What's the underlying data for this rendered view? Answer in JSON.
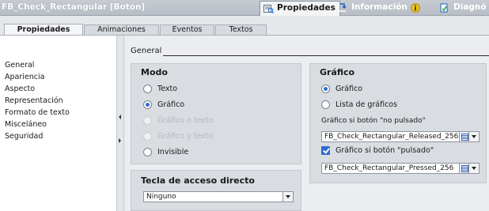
{
  "window": {
    "title": "FB_Check_Rectangular [Botón]"
  },
  "inspector_tabs": [
    {
      "label": "Propiedades",
      "icon": "properties-icon",
      "active": true
    },
    {
      "label": "Información",
      "icon": "info-link-icon",
      "badge_icon": "info-badge-icon",
      "active": false
    },
    {
      "label": "Diagnó",
      "icon": "diagnostics-icon",
      "active": false
    }
  ],
  "sub_tabs": [
    {
      "label": "Propiedades",
      "active": true
    },
    {
      "label": "Animaciones",
      "active": false
    },
    {
      "label": "Eventos",
      "active": false
    },
    {
      "label": "Textos",
      "active": false
    }
  ],
  "nav": {
    "items": [
      {
        "label": "General",
        "selected": true
      },
      {
        "label": "Apariencia",
        "selected": false
      },
      {
        "label": "Aspecto",
        "selected": false
      },
      {
        "label": "Representación",
        "selected": false
      },
      {
        "label": "Formato de texto",
        "selected": false
      },
      {
        "label": "Misceláneo",
        "selected": false
      },
      {
        "label": "Seguridad",
        "selected": false
      }
    ]
  },
  "main": {
    "section_title": "General",
    "modo": {
      "title": "Modo",
      "options": [
        {
          "label": "Texto",
          "checked": false,
          "disabled": false
        },
        {
          "label": "Gráfico",
          "checked": true,
          "disabled": false
        },
        {
          "label": "Gráfico o texto",
          "checked": false,
          "disabled": true
        },
        {
          "label": "Gráfico y texto",
          "checked": false,
          "disabled": true
        },
        {
          "label": "Invisible",
          "checked": false,
          "disabled": false
        }
      ]
    },
    "hotkey": {
      "title": "Tecla de acceso directo",
      "value": "Ninguno"
    },
    "grafico": {
      "title": "Gráfico",
      "options": [
        {
          "label": "Gráfico",
          "checked": true
        },
        {
          "label": "Lista de gráficos",
          "checked": false
        }
      ],
      "released_label": "Gráfico si botón \"no pulsado\"",
      "released_value": "FB_Check_Rectangular_Released_256",
      "pressed_checked": true,
      "pressed_label": "Gráfico si botón \"pulsado\"",
      "pressed_value": "FB_Check_Rectangular_Pressed_256"
    }
  },
  "colors": {
    "accent": "#2b6cd4",
    "title_bar": "#c6cbd2",
    "panel_group": "#d9dce1",
    "info_badge": "#f0c419"
  }
}
